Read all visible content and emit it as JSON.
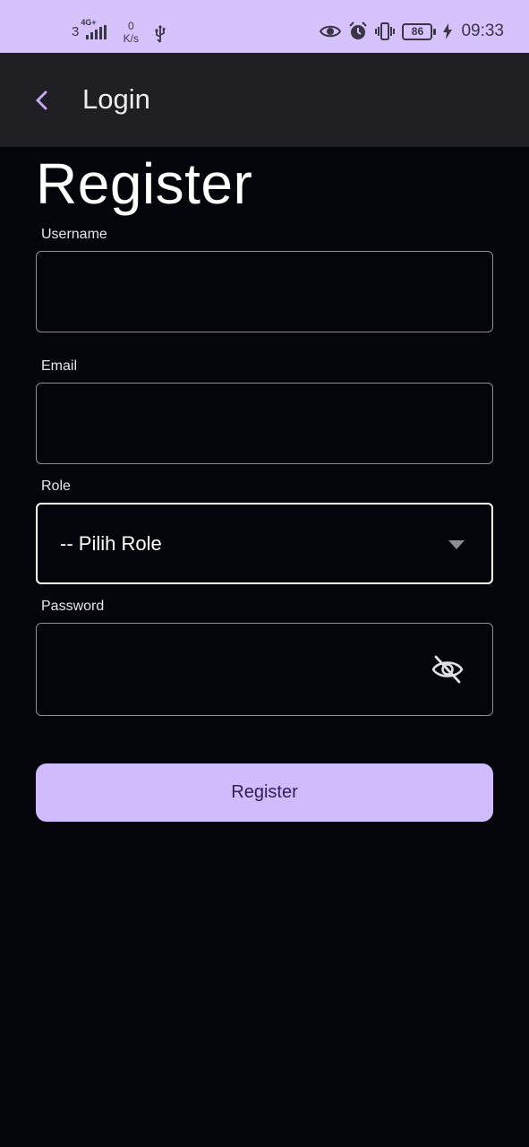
{
  "status_bar": {
    "carrier": "3",
    "network_type": "4G+",
    "data_speed_value": "0",
    "data_speed_unit": "K/s",
    "battery_level": "86",
    "time": "09:33"
  },
  "app_bar": {
    "title": "Login"
  },
  "page": {
    "title": "Register"
  },
  "form": {
    "username": {
      "label": "Username",
      "value": ""
    },
    "email": {
      "label": "Email",
      "value": ""
    },
    "role": {
      "label": "Role",
      "selected": "-- Pilih Role"
    },
    "password": {
      "label": "Password",
      "value": ""
    },
    "submit_label": "Register"
  },
  "colors": {
    "status_bar_bg": "#d6c3fc",
    "app_bar_bg": "#1f1f23",
    "background": "#03050a",
    "primary_button": "#d0bcfd",
    "accent": "#c7a8f5"
  }
}
